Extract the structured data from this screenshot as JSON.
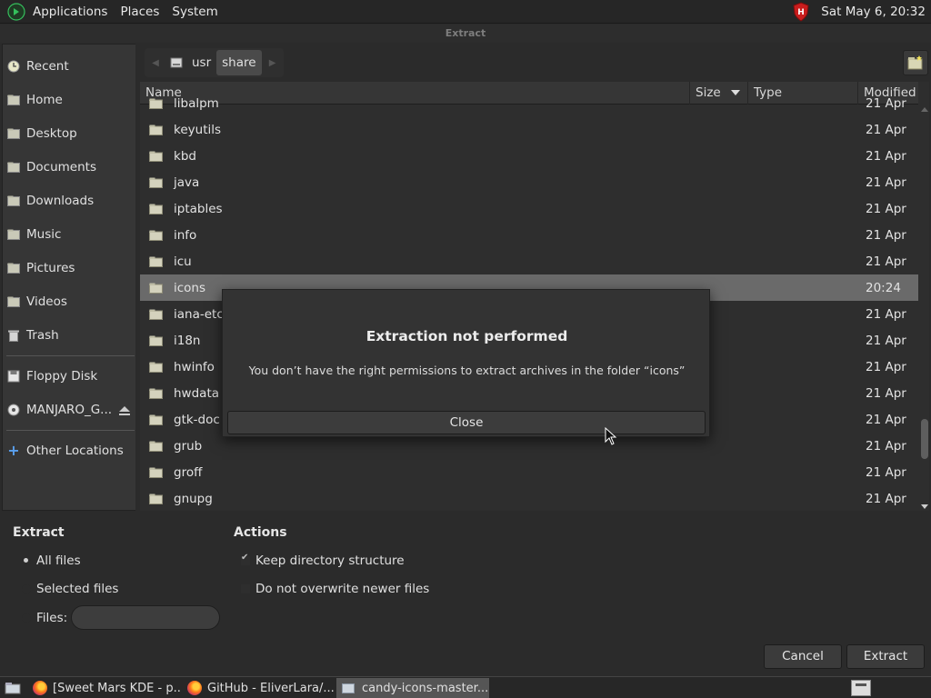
{
  "top_panel": {
    "menus": [
      "Applications",
      "Places",
      "System"
    ],
    "clock": "Sat May  6, 20:32"
  },
  "window": {
    "title": "Extract"
  },
  "sidebar": {
    "items": [
      {
        "label": "Recent",
        "icon": "recent-icon"
      },
      {
        "label": "Home",
        "icon": "home-folder-icon"
      },
      {
        "label": "Desktop",
        "icon": "desktop-folder-icon"
      },
      {
        "label": "Documents",
        "icon": "documents-folder-icon"
      },
      {
        "label": "Downloads",
        "icon": "downloads-folder-icon"
      },
      {
        "label": "Music",
        "icon": "music-folder-icon"
      },
      {
        "label": "Pictures",
        "icon": "pictures-folder-icon"
      },
      {
        "label": "Videos",
        "icon": "videos-folder-icon"
      },
      {
        "label": "Trash",
        "icon": "trash-icon"
      }
    ],
    "devices": [
      {
        "label": "Floppy Disk",
        "icon": "floppy-icon"
      },
      {
        "label": "MANJARO_G...",
        "icon": "disc-icon"
      }
    ],
    "other": {
      "label": "Other Locations",
      "icon": "plus-icon"
    }
  },
  "pathbar": {
    "segments": [
      "usr",
      "share"
    ],
    "active": "share"
  },
  "list": {
    "columns": {
      "name": "Name",
      "size": "Size",
      "type": "Type",
      "modified": "Modified"
    },
    "rows": [
      {
        "name": "libalpm",
        "modified": "21 Apr"
      },
      {
        "name": "keyutils",
        "modified": "21 Apr"
      },
      {
        "name": "kbd",
        "modified": "21 Apr"
      },
      {
        "name": "java",
        "modified": "21 Apr"
      },
      {
        "name": "iptables",
        "modified": "21 Apr"
      },
      {
        "name": "info",
        "modified": "21 Apr"
      },
      {
        "name": "icu",
        "modified": "21 Apr"
      },
      {
        "name": "icons",
        "modified": "20:24",
        "selected": true
      },
      {
        "name": "iana-etc",
        "modified": "21 Apr"
      },
      {
        "name": "i18n",
        "modified": "21 Apr"
      },
      {
        "name": "hwinfo",
        "modified": "21 Apr"
      },
      {
        "name": "hwdata",
        "modified": "21 Apr"
      },
      {
        "name": "gtk-doc",
        "modified": "21 Apr"
      },
      {
        "name": "grub",
        "modified": "21 Apr"
      },
      {
        "name": "groff",
        "modified": "21 Apr"
      },
      {
        "name": "gnupg",
        "modified": "21 Apr"
      }
    ]
  },
  "options": {
    "extract_title": "Extract",
    "all_files": "All files",
    "selected_files": "Selected files",
    "files_label": "Files:",
    "files_value": "",
    "actions_title": "Actions",
    "keep_dirs": "Keep directory structure",
    "no_overwrite": "Do not overwrite newer files",
    "cancel": "Cancel",
    "extract": "Extract"
  },
  "dialog": {
    "title": "Extraction not performed",
    "message": "You don’t have the right permissions to extract archives in the folder “icons”",
    "close": "Close"
  },
  "taskbar": {
    "tasks": [
      "[Sweet Mars KDE - p...",
      "GitHub - EliverLara/...",
      "candy-icons-master...."
    ]
  },
  "colors": {
    "selected_row": "#6a6a6a",
    "background": "#2b2b2b"
  }
}
